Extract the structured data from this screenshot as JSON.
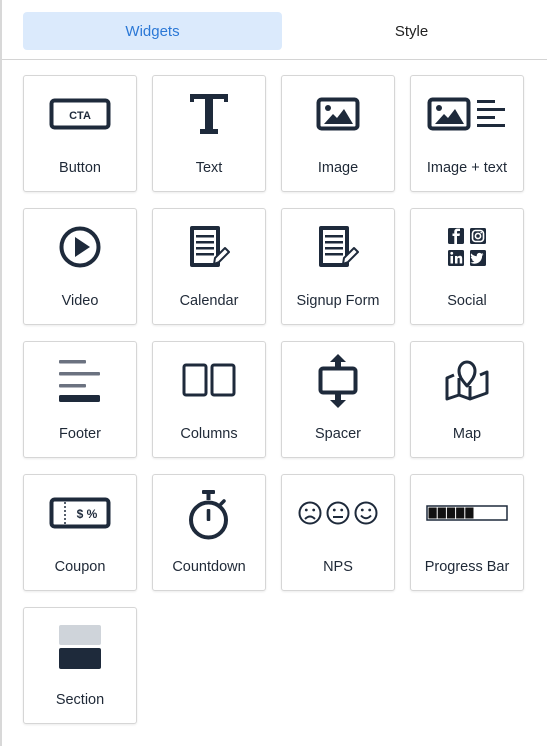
{
  "tabs": [
    {
      "label": "Widgets",
      "active": true
    },
    {
      "label": "Style",
      "active": false
    }
  ],
  "colors": {
    "active_tab_bg": "#dbeafc",
    "active_tab_text": "#2b78d6",
    "icon": "#1e2a3b",
    "section_top_block": "#cfd4da"
  },
  "widgets": [
    {
      "label": "Button",
      "icon": "cta-button-icon",
      "icon_text": "CTA"
    },
    {
      "label": "Text",
      "icon": "text-t-icon"
    },
    {
      "label": "Image",
      "icon": "image-icon"
    },
    {
      "label": "Image + text",
      "icon": "image-text-icon"
    },
    {
      "label": "Video",
      "icon": "play-circle-icon"
    },
    {
      "label": "Calendar",
      "icon": "document-pen-icon"
    },
    {
      "label": "Signup Form",
      "icon": "document-pen-icon"
    },
    {
      "label": "Social",
      "icon": "social-icons-grid"
    },
    {
      "label": "Footer",
      "icon": "footer-lines-icon"
    },
    {
      "label": "Columns",
      "icon": "columns-icon"
    },
    {
      "label": "Spacer",
      "icon": "spacer-arrows-icon"
    },
    {
      "label": "Map",
      "icon": "map-pin-icon"
    },
    {
      "label": "Coupon",
      "icon": "coupon-ticket-icon",
      "icon_text": "$ %"
    },
    {
      "label": "Countdown",
      "icon": "stopwatch-icon"
    },
    {
      "label": "NPS",
      "icon": "faces-icon"
    },
    {
      "label": "Progress Bar",
      "icon": "progress-bar-icon",
      "progress_segments_filled": 5,
      "progress_fraction": 0.55
    },
    {
      "label": "Section",
      "icon": "section-blocks-icon"
    }
  ]
}
